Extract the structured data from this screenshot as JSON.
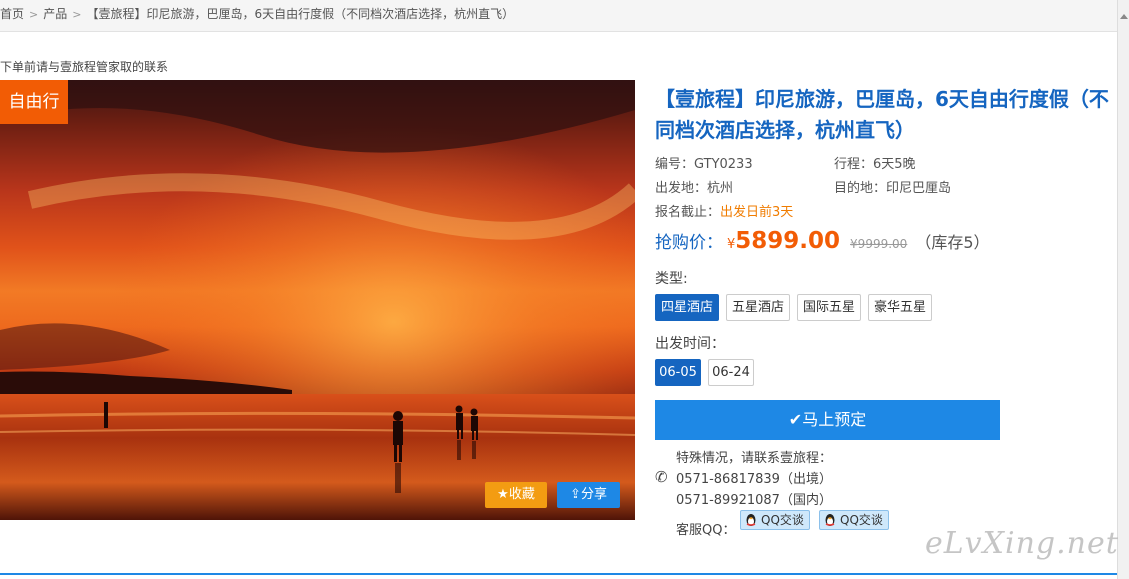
{
  "breadcrumb": {
    "home": "首页",
    "products": "产品",
    "current": "【壹旅程】印尼旅游，巴厘岛，6天自由行度假（不同档次酒店选择，杭州直飞）"
  },
  "notice": "下单前请与壹旅程管家取的联系",
  "hero": {
    "badge": "自由行",
    "favorite_label": "收藏",
    "share_label": "分享"
  },
  "product": {
    "title": "【壹旅程】印尼旅游，巴厘岛，6天自由行度假（不同档次酒店选择，杭州直飞）",
    "code_label": "编号：",
    "code": "GTY0233",
    "duration_label": "行程：",
    "duration": "6天5晚",
    "departure_label": "出发地：",
    "departure": "杭州",
    "destination_label": "目的地：",
    "destination": "印尼巴厘岛",
    "deadline_label": "报名截止：",
    "deadline": "出发日前3天"
  },
  "pricing": {
    "label": "抢购价：",
    "currency": "¥",
    "price": "5899.00",
    "original": "¥9999.00",
    "stock": "（库存5）"
  },
  "type_options": {
    "label": "类型:",
    "items": [
      "四星酒店",
      "五星酒店",
      "国际五星",
      "豪华五星"
    ],
    "selected": "四星酒店"
  },
  "dates": {
    "label": "出发时间：",
    "items": [
      "06-05",
      "06-24"
    ],
    "selected": "06-05"
  },
  "book_label": "马上预定",
  "contact": {
    "intro": "特殊情况，请联系壹旅程：",
    "phone1": "0571-86817839（出境）",
    "phone2": "0571-89921087（国内）",
    "qq_label": "客服QQ：",
    "qq_button_1": "QQ交谈",
    "qq_button_2": "QQ交谈"
  },
  "watermark": "eLvXing.net",
  "colors": {
    "accent_blue": "#1565c0",
    "button_blue": "#1e88e5",
    "price_orange": "#f25c05"
  }
}
